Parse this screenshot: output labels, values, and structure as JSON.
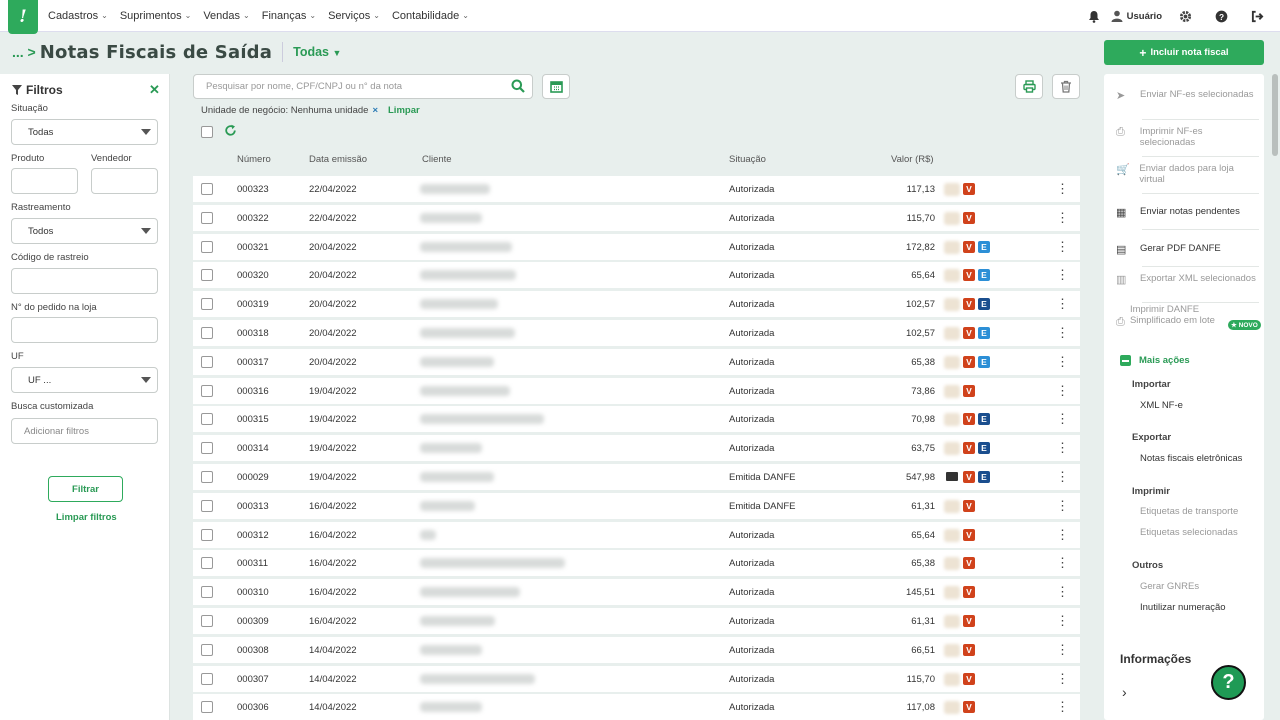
{
  "topbar": {
    "logo_glyph": "!",
    "menu": [
      "Cadastros",
      "Suprimentos",
      "Vendas",
      "Finanças",
      "Serviços",
      "Contabilidade"
    ],
    "user_label": "Usuário"
  },
  "header": {
    "breadcrumb": "... >",
    "title": "Notas Fiscais de Saída",
    "view_filter": "Todas",
    "include_button": "Incluir nota fiscal"
  },
  "filters": {
    "title": "Filtros",
    "situacao_label": "Situação",
    "situacao_value": "Todas",
    "produto_label": "Produto",
    "vendedor_label": "Vendedor",
    "rastreamento_label": "Rastreamento",
    "rastreamento_value": "Todos",
    "codigo_label": "Código de rastreio",
    "pedido_label": "N° do pedido na loja",
    "uf_label": "UF",
    "uf_value": "UF ...",
    "busca_label": "Busca customizada",
    "busca_placeholder": "Adicionar filtros",
    "filter_button": "Filtrar",
    "clear_link": "Limpar filtros"
  },
  "search": {
    "placeholder": "Pesquisar por nome, CPF/CNPJ ou n° da nota"
  },
  "business_unit": {
    "text": "Unidade de negócio: Nenhuma unidade",
    "remove_glyph": "×",
    "clear_label": "Limpar"
  },
  "table": {
    "headers": [
      "Número",
      "Data emissão",
      "Cliente",
      "Situação",
      "Valor (R$)"
    ],
    "rows": [
      {
        "numero": "000323",
        "data": "22/04/2022",
        "situacao": "Autorizada",
        "valor": "117,13",
        "mail": false,
        "e": ""
      },
      {
        "numero": "000322",
        "data": "22/04/2022",
        "situacao": "Autorizada",
        "valor": "115,70",
        "mail": false,
        "e": ""
      },
      {
        "numero": "000321",
        "data": "20/04/2022",
        "situacao": "Autorizada",
        "valor": "172,82",
        "mail": false,
        "e": "light"
      },
      {
        "numero": "000320",
        "data": "20/04/2022",
        "situacao": "Autorizada",
        "valor": "65,64",
        "mail": false,
        "e": "light"
      },
      {
        "numero": "000319",
        "data": "20/04/2022",
        "situacao": "Autorizada",
        "valor": "102,57",
        "mail": false,
        "e": "dark"
      },
      {
        "numero": "000318",
        "data": "20/04/2022",
        "situacao": "Autorizada",
        "valor": "102,57",
        "mail": false,
        "e": "light"
      },
      {
        "numero": "000317",
        "data": "20/04/2022",
        "situacao": "Autorizada",
        "valor": "65,38",
        "mail": false,
        "e": "light"
      },
      {
        "numero": "000316",
        "data": "19/04/2022",
        "situacao": "Autorizada",
        "valor": "73,86",
        "mail": false,
        "e": ""
      },
      {
        "numero": "000315",
        "data": "19/04/2022",
        "situacao": "Autorizada",
        "valor": "70,98",
        "mail": false,
        "e": "dark"
      },
      {
        "numero": "000314",
        "data": "19/04/2022",
        "situacao": "Autorizada",
        "valor": "63,75",
        "mail": false,
        "e": "dark"
      },
      {
        "numero": "000029",
        "data": "19/04/2022",
        "situacao": "Emitida DANFE",
        "valor": "547,98",
        "mail": true,
        "e": "dark"
      },
      {
        "numero": "000313",
        "data": "16/04/2022",
        "situacao": "Emitida DANFE",
        "valor": "61,31",
        "mail": false,
        "e": ""
      },
      {
        "numero": "000312",
        "data": "16/04/2022",
        "situacao": "Autorizada",
        "valor": "65,64",
        "mail": false,
        "e": ""
      },
      {
        "numero": "000311",
        "data": "16/04/2022",
        "situacao": "Autorizada",
        "valor": "65,38",
        "mail": false,
        "e": ""
      },
      {
        "numero": "000310",
        "data": "16/04/2022",
        "situacao": "Autorizada",
        "valor": "145,51",
        "mail": false,
        "e": ""
      },
      {
        "numero": "000309",
        "data": "16/04/2022",
        "situacao": "Autorizada",
        "valor": "61,31",
        "mail": false,
        "e": ""
      },
      {
        "numero": "000308",
        "data": "14/04/2022",
        "situacao": "Autorizada",
        "valor": "66,51",
        "mail": false,
        "e": ""
      },
      {
        "numero": "000307",
        "data": "14/04/2022",
        "situacao": "Autorizada",
        "valor": "115,70",
        "mail": false,
        "e": ""
      },
      {
        "numero": "000306",
        "data": "14/04/2022",
        "situacao": "Autorizada",
        "valor": "117,08",
        "mail": false,
        "e": ""
      }
    ]
  },
  "sidebar": {
    "actions": [
      {
        "label": "Enviar NF-es selecionadas",
        "active": false,
        "icon": "send-icon"
      },
      {
        "label": "Imprimir NF-es selecionadas",
        "active": false,
        "icon": "printer-icon"
      },
      {
        "label": "Enviar dados para loja virtual",
        "active": false,
        "icon": "cart-icon"
      },
      {
        "label": "Enviar notas pendentes",
        "active": true,
        "icon": "calendar-icon"
      },
      {
        "label": "Gerar PDF DANFE",
        "active": true,
        "icon": "pdf-file-icon"
      },
      {
        "label": "Exportar XML selecionados",
        "active": false,
        "icon": "xml-file-icon"
      },
      {
        "label": "Imprimir DANFE Simplificado em lote",
        "active": false,
        "icon": "printer-icon"
      }
    ],
    "novo_badge": "★ NOVO",
    "mais_acoes": "Mais ações",
    "sections": [
      {
        "title": "Importar",
        "links": [
          {
            "label": "XML NF-e",
            "dim": false
          }
        ]
      },
      {
        "title": "Exportar",
        "links": [
          {
            "label": "Notas fiscais eletrônicas",
            "dim": false
          }
        ]
      },
      {
        "title": "Imprimir",
        "links": [
          {
            "label": "Etiquetas de transporte",
            "dim": true
          },
          {
            "label": "Etiquetas selecionadas",
            "dim": true
          }
        ]
      },
      {
        "title": "Outros",
        "links": [
          {
            "label": "Gerar GNREs",
            "dim": true
          },
          {
            "label": "Inutilizar numeração",
            "dim": false
          }
        ]
      }
    ],
    "info_title": "Informações"
  },
  "colors": {
    "brand": "#2eaa5c",
    "v_badge": "#d0421b",
    "e_light": "#2c8fd6",
    "e_dark": "#1a4e8e"
  }
}
